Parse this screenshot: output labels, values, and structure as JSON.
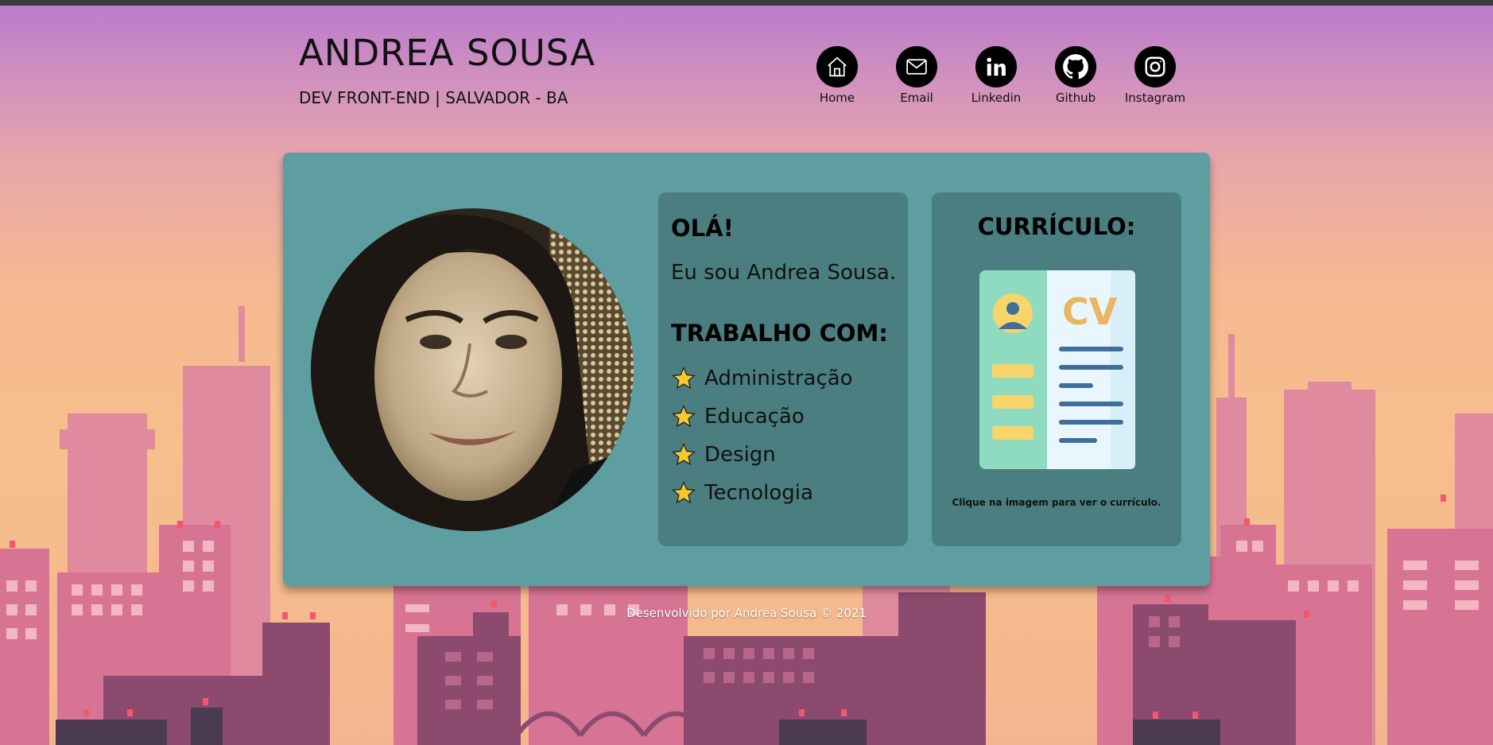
{
  "header": {
    "name": "ANDREA SOUSA",
    "subtitle": "DEV FRONT-END | SALVADOR - BA"
  },
  "nav": [
    {
      "label": "Home",
      "icon": "home-icon"
    },
    {
      "label": "Email",
      "icon": "envelope-icon"
    },
    {
      "label": "Linkedin",
      "icon": "linkedin-icon"
    },
    {
      "label": "Github",
      "icon": "github-icon"
    },
    {
      "label": "Instagram",
      "icon": "instagram-icon"
    }
  ],
  "intro": {
    "greeting": "OLÁ!",
    "text": "Eu sou Andrea Sousa.",
    "work_title": "TRABALHO COM:",
    "skills": [
      "Administração",
      "Educação",
      "Design",
      "Tecnologia"
    ]
  },
  "resume": {
    "title": "CURRÍCULO:",
    "cv_text": "CV",
    "hint": "Clique na imagem para ver o currículo."
  },
  "footer": {
    "text": "Desenvolvido por Andrea Sousa © 2021"
  },
  "colors": {
    "card": "#5e9ea1",
    "panel": "#4b7e80",
    "star": "#f7c830",
    "accent_cv": "#e8b75f"
  }
}
